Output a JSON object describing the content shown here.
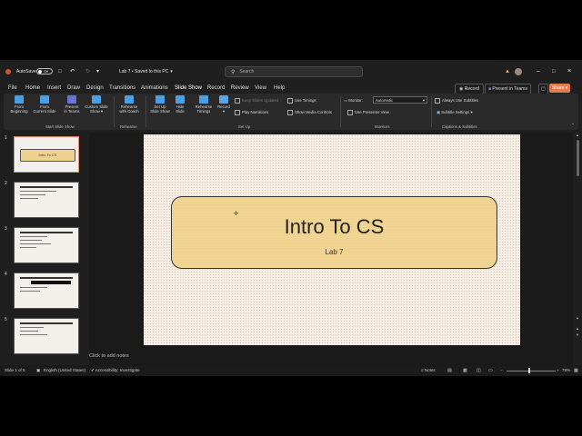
{
  "titlebar": {
    "autosave": "AutoSave",
    "autosave_state": "Off",
    "doc_title": "Lab 7 • Saved to this PC",
    "search_placeholder": "Search"
  },
  "menu": {
    "tabs": [
      "File",
      "Home",
      "Insert",
      "Draw",
      "Design",
      "Transitions",
      "Animations",
      "Slide Show",
      "Record",
      "Review",
      "View",
      "Help"
    ],
    "active_tab": "Slide Show",
    "record_btn": "Record",
    "present_teams_btn": "Present in Teams",
    "share_btn": "Share"
  },
  "ribbon": {
    "start": {
      "from_beginning": [
        "From",
        "Beginning"
      ],
      "from_current": [
        "From",
        "Current Slide"
      ],
      "present_teams": [
        "Present",
        "in Teams"
      ],
      "custom_show": [
        "Custom Slide",
        "Show"
      ],
      "group": "Start Slide Show"
    },
    "rehearse": {
      "coach": [
        "Rehearse",
        "with Coach"
      ],
      "group": "Rehearse"
    },
    "setup": {
      "setup_show": [
        "Set Up",
        "Slide Show"
      ],
      "hide_slide": [
        "Hide",
        "Slide"
      ],
      "rehearse_timings": [
        "Rehearse",
        "Timings"
      ],
      "record": "Record",
      "keep_updated": "Keep Slides Updated",
      "play_narrations": "Play Narrations",
      "use_timings": "Use Timings",
      "show_media": "Show Media Controls",
      "group": "Set Up"
    },
    "monitors": {
      "monitor_label": "Monitor:",
      "monitor_value": "Automatic",
      "presenter_view": "Use Presenter View",
      "group": "Monitors"
    },
    "captions": {
      "always_subtitles": "Always Use Subtitles",
      "subtitle_settings": "Subtitle Settings",
      "group": "Captions & Subtitles"
    }
  },
  "slides": {
    "numbers": [
      "1",
      "2",
      "3",
      "4",
      "5"
    ],
    "thumb1_title": "Intro To CS"
  },
  "slide": {
    "title": "Intro To CS",
    "subtitle": "Lab 7"
  },
  "notes_placeholder": "Click to add notes",
  "status": {
    "slide_count": "Slide 1 of 5",
    "language": "English (United States)",
    "accessibility": "Accessibility: Investigate",
    "notes": "Notes",
    "zoom": "78%"
  }
}
